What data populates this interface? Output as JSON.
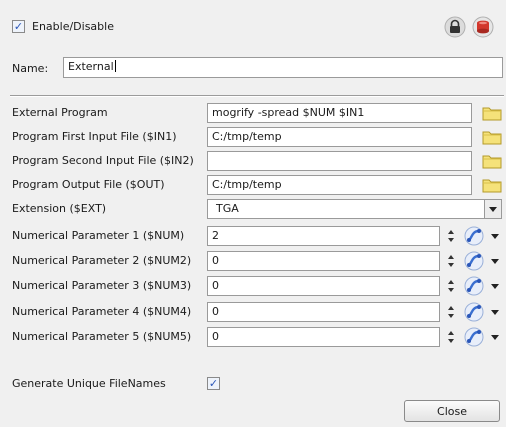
{
  "header": {
    "enable_label": "Enable/Disable",
    "enable_checked": true
  },
  "name": {
    "label": "Name:",
    "value": "External"
  },
  "fields": [
    {
      "label": "External Program",
      "value": "mogrify -spread $NUM $IN1",
      "kind": "text-folder"
    },
    {
      "label": "Program First Input File ($IN1)",
      "value": "C:/tmp/temp",
      "kind": "text-folder"
    },
    {
      "label": "Program Second Input File ($IN2)",
      "value": "",
      "kind": "text-folder"
    },
    {
      "label": "Program Output File ($OUT)",
      "value": "C:/tmp/temp",
      "kind": "text-folder"
    },
    {
      "label": "Extension ($EXT)",
      "value": "TGA",
      "kind": "dropdown"
    },
    {
      "label": "Numerical Parameter 1 ($NUM)",
      "value": "2",
      "kind": "number"
    },
    {
      "label": "Numerical Parameter 2 ($NUM2)",
      "value": "0",
      "kind": "number"
    },
    {
      "label": "Numerical Parameter 3 ($NUM3)",
      "value": "0",
      "kind": "number"
    },
    {
      "label": "Numerical Parameter 4 ($NUM4)",
      "value": "0",
      "kind": "number"
    },
    {
      "label": "Numerical Parameter 5 ($NUM5)",
      "value": "0",
      "kind": "number"
    }
  ],
  "unique": {
    "label": "Generate Unique FileNames",
    "checked": true
  },
  "close_label": "Close",
  "colors": {
    "background": "#f0f0f0",
    "folder": "#f5e27a",
    "curve_blue": "#3a6fd0",
    "lock_red": "#d2372c"
  },
  "icons": [
    "lock-icon",
    "reset-icon",
    "folder-icon",
    "dropdown-arrow-icon",
    "spinner-icon",
    "curve-icon"
  ]
}
